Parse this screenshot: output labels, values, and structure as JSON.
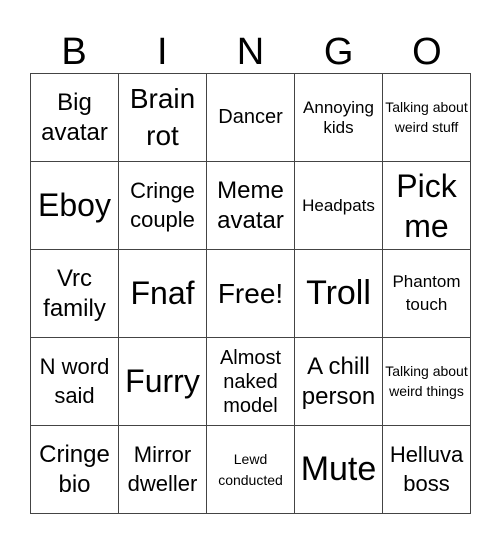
{
  "header": {
    "letters": [
      "B",
      "I",
      "N",
      "G",
      "O"
    ]
  },
  "grid": {
    "rows": [
      [
        "Big avatar",
        "Brain rot",
        "Dancer",
        "Annoying kids",
        "Talking about weird stuff"
      ],
      [
        "Eboy",
        "Cringe couple",
        "Meme avatar",
        "Headpats",
        "Pick me"
      ],
      [
        "Vrc family",
        "Fnaf",
        "Free!",
        "Troll",
        "Phantom touch"
      ],
      [
        "N word said",
        "Furry",
        "Almost naked model",
        "A chill person",
        "Talking about weird things"
      ],
      [
        "Cringe bio",
        "Mirror dweller",
        "Lewd conducted",
        "Mute",
        "Helluva boss"
      ]
    ],
    "free_space": "Free!"
  }
}
